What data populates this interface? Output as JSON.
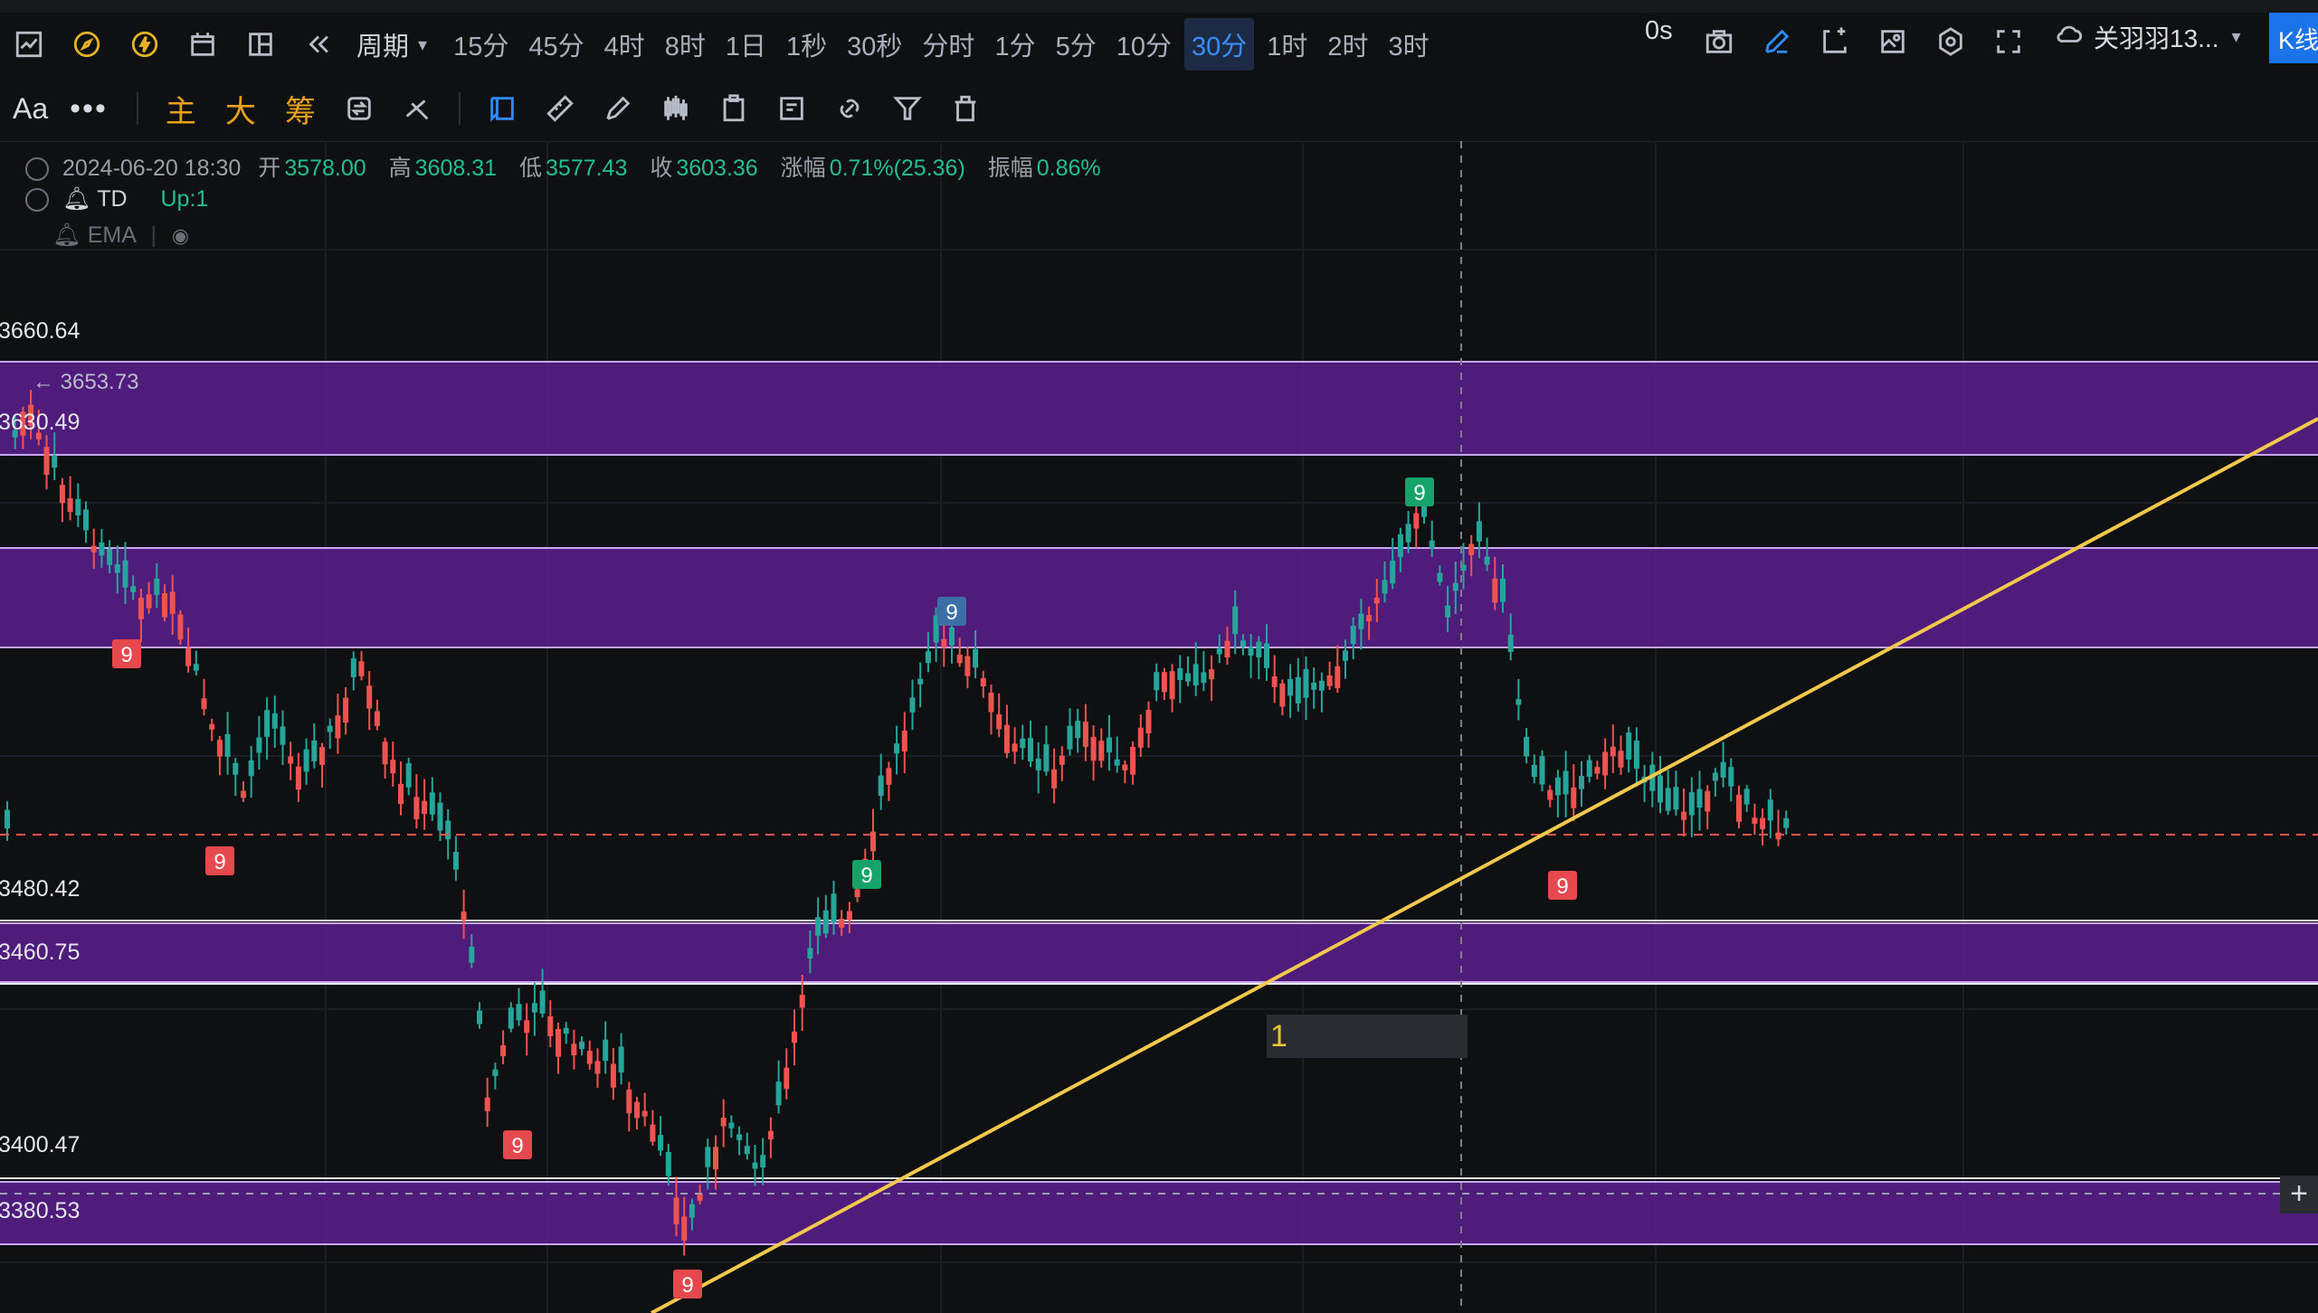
{
  "toolbar": {
    "period_label": "周期",
    "timeframes": [
      "15分",
      "45分",
      "4时",
      "8时",
      "1日",
      "1秒",
      "30秒",
      "分时",
      "1分",
      "5分",
      "10分",
      "30分",
      "1时",
      "2时",
      "3时"
    ],
    "active_timeframe": "30分",
    "latency": "0s",
    "account_name": "关羽羽13...",
    "kline_label": "K线",
    "left_icons": [
      "line-chart-icon",
      "compass-icon",
      "lightning-icon",
      "calendar-icon",
      "layout-icon",
      "rewind-icon"
    ],
    "right_icons": [
      "camera-icon",
      "pencil-icon",
      "frame-icon",
      "image-icon",
      "settings-icon",
      "fullscreen-icon",
      "cloud-icon"
    ]
  },
  "drawing_toolbar": {
    "font_label": "Aa",
    "more_label": "•••",
    "main_label": "主",
    "big_label": "大",
    "chip_label": "筹",
    "icons": [
      "swap-icon",
      "scissors-icon",
      "bookmark-icon",
      "ruler-icon",
      "pen-icon",
      "candle-icon",
      "clipboard-icon",
      "note-icon",
      "link-icon",
      "filter-icon",
      "trash-icon"
    ]
  },
  "info": {
    "datetime": "2024-06-20 18:30",
    "open_label": "开",
    "open": "3578.00",
    "high_label": "高",
    "high": "3608.31",
    "low_label": "低",
    "low": "3577.43",
    "close_label": "收",
    "close": "3603.36",
    "change_label": "涨幅",
    "change": "0.71%(25.36)",
    "amplitude_label": "振幅",
    "amplitude": "0.86%"
  },
  "indicators": {
    "td_name": "TD",
    "td_value": "Up:1",
    "ema_name": "EMA"
  },
  "chart_data": {
    "type": "candlestick",
    "price_labels": [
      "3660.64",
      "3630.49",
      "3480.42",
      "3460.75",
      "3400.47",
      "3380.53"
    ],
    "high_marker": "3653.73",
    "td_markers": [
      "9",
      "9",
      "9",
      "9",
      "9",
      "9",
      "9",
      "9"
    ],
    "trend_label": "1",
    "colors": {
      "up": "#26a69a",
      "down": "#ef5350",
      "zone": "#5b1f8f",
      "trendline": "#f2c94c"
    }
  }
}
